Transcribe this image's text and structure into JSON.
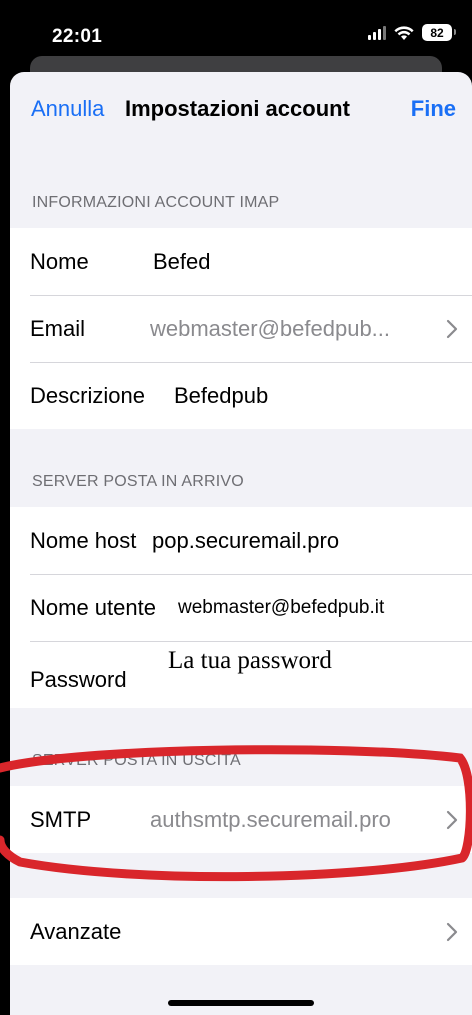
{
  "status_bar": {
    "time": "22:01",
    "battery_level": "82",
    "icons": [
      "cellular-signal-icon",
      "wifi-icon",
      "battery-icon"
    ]
  },
  "nav": {
    "cancel_label": "Annulla",
    "title": "Impostazioni account",
    "done_label": "Fine"
  },
  "sections": {
    "imap": {
      "header": "INFORMAZIONI ACCOUNT IMAP",
      "name_label": "Nome",
      "name_value": "Befed",
      "email_label": "Email",
      "email_value": "webmaster@befedpub...",
      "description_label": "Descrizione",
      "description_value": "Befedpub"
    },
    "incoming": {
      "header": "SERVER POSTA IN ARRIVO",
      "host_label": "Nome host",
      "host_value": "pop.securemail.pro",
      "user_label": "Nome utente",
      "user_value": "webmaster@befedpub.it",
      "password_label": "Password",
      "password_value": "La tua password"
    },
    "outgoing": {
      "header": "SERVER POSTA IN USCITA",
      "smtp_label": "SMTP",
      "smtp_value": "authsmtp.securemail.pro"
    },
    "advanced": {
      "label": "Avanzate"
    }
  },
  "colors": {
    "accent": "#1a6ff5",
    "background": "#f2f2f7",
    "annotation": "#d9262b",
    "muted_text": "#8a8a8e"
  }
}
